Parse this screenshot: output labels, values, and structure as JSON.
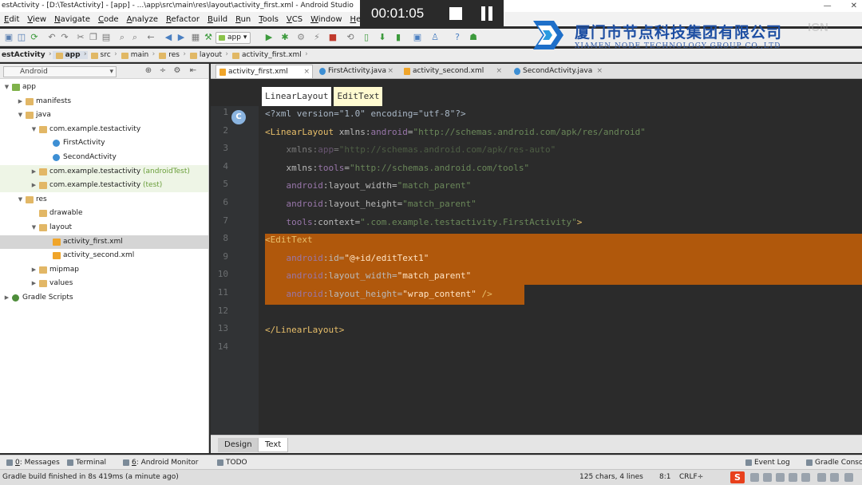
{
  "window": {
    "title": "estActivity - [D:\\TestActivity] - [app] - ...\\app\\src\\main\\res\\layout\\activity_first.xml - Android Studio"
  },
  "menu": [
    "Edit",
    "View",
    "Navigate",
    "Code",
    "Analyze",
    "Refactor",
    "Build",
    "Run",
    "Tools",
    "VCS",
    "Window",
    "Help"
  ],
  "toolbar": {
    "module": "app"
  },
  "breadcrumb": [
    "estActivity",
    "app",
    "src",
    "main",
    "res",
    "layout",
    "activity_first.xml"
  ],
  "project_panel": {
    "view_mode": "Android",
    "tree": [
      {
        "label": "app",
        "depth": 0,
        "arrow": "▼",
        "icon": "module"
      },
      {
        "label": "manifests",
        "depth": 1,
        "arrow": "▶",
        "icon": "folder"
      },
      {
        "label": "java",
        "depth": 1,
        "arrow": "▼",
        "icon": "folder"
      },
      {
        "label": "com.example.testactivity",
        "depth": 2,
        "arrow": "▼",
        "icon": "folder"
      },
      {
        "label": "FirstActivity",
        "depth": 3,
        "arrow": "",
        "icon": "class"
      },
      {
        "label": "SecondActivity",
        "depth": 3,
        "arrow": "",
        "icon": "class"
      },
      {
        "label": "com.example.testactivity",
        "suffix": "(androidTest)",
        "depth": 2,
        "arrow": "▶",
        "icon": "folder",
        "tinted": true
      },
      {
        "label": "com.example.testactivity",
        "suffix": "(test)",
        "depth": 2,
        "arrow": "▶",
        "icon": "folder",
        "tinted": true
      },
      {
        "label": "res",
        "depth": 1,
        "arrow": "▼",
        "icon": "folder"
      },
      {
        "label": "drawable",
        "depth": 2,
        "arrow": "",
        "icon": "folder"
      },
      {
        "label": "layout",
        "depth": 2,
        "arrow": "▼",
        "icon": "folder"
      },
      {
        "label": "activity_first.xml",
        "depth": 3,
        "arrow": "",
        "icon": "xml",
        "selected": true
      },
      {
        "label": "activity_second.xml",
        "depth": 3,
        "arrow": "",
        "icon": "xml"
      },
      {
        "label": "mipmap",
        "depth": 2,
        "arrow": "▶",
        "icon": "folder"
      },
      {
        "label": "values",
        "depth": 2,
        "arrow": "▶",
        "icon": "folder"
      },
      {
        "label": "Gradle Scripts",
        "depth": 0,
        "arrow": "▶",
        "icon": "gradle"
      }
    ]
  },
  "editor": {
    "tabs": [
      {
        "label": "activity_first.xml",
        "type": "xml",
        "active": true
      },
      {
        "label": "FirstActivity.java",
        "type": "java",
        "active": false
      },
      {
        "label": "activity_second.xml",
        "type": "xml",
        "active": false
      },
      {
        "label": "SecondActivity.java",
        "type": "java",
        "active": false
      }
    ],
    "tag_breadcrumb": [
      "LinearLayout",
      "EditText"
    ],
    "gutter_marker": "C",
    "line_numbers": [
      "1",
      "2",
      "3",
      "4",
      "5",
      "6",
      "7",
      "8",
      "9",
      "10",
      "11",
      "12",
      "13",
      "14"
    ],
    "selected_lines": [
      8,
      11
    ],
    "code": [
      [
        [
          "t",
          "<?xml version=\"1.0\" encoding=\"utf-8\"?>"
        ]
      ],
      [
        [
          "tag",
          "<LinearLayout "
        ],
        [
          "attr",
          "xmlns:"
        ],
        [
          "ns",
          "android"
        ],
        [
          "attr",
          "="
        ],
        [
          "val",
          "\"http://schemas.android.com/apk/res/android\""
        ]
      ],
      [
        [
          "t",
          "    "
        ],
        [
          "attr",
          "xmlns:"
        ],
        [
          "ns",
          "app"
        ],
        [
          "attr",
          "="
        ],
        [
          "val",
          "\"http://schemas.android.com/apk/res-auto\""
        ]
      ],
      [
        [
          "t",
          "    "
        ],
        [
          "attr",
          "xmlns:"
        ],
        [
          "ns",
          "tools"
        ],
        [
          "attr",
          "="
        ],
        [
          "val",
          "\"http://schemas.android.com/tools\""
        ]
      ],
      [
        [
          "t",
          "    "
        ],
        [
          "ns",
          "android"
        ],
        [
          "attr",
          ":layout_width="
        ],
        [
          "val",
          "\"match_parent\""
        ]
      ],
      [
        [
          "t",
          "    "
        ],
        [
          "ns",
          "android"
        ],
        [
          "attr",
          ":layout_height="
        ],
        [
          "val",
          "\"match_parent\""
        ]
      ],
      [
        [
          "t",
          "    "
        ],
        [
          "ns",
          "tools"
        ],
        [
          "attr",
          ":context="
        ],
        [
          "val",
          "\".com.example.testactivity.FirstActivity\""
        ],
        [
          "tag",
          ">"
        ]
      ],
      [
        [
          "tag",
          "<EditText"
        ]
      ],
      [
        [
          "t",
          "    "
        ],
        [
          "ns",
          "android"
        ],
        [
          "attr",
          ":id="
        ],
        [
          "val",
          "\"@+id/editText1\""
        ]
      ],
      [
        [
          "t",
          "    "
        ],
        [
          "ns",
          "android"
        ],
        [
          "attr",
          ":layout_width="
        ],
        [
          "val",
          "\"match_parent\""
        ]
      ],
      [
        [
          "t",
          "    "
        ],
        [
          "ns",
          "android"
        ],
        [
          "attr",
          ":layout_height="
        ],
        [
          "val",
          "\"wrap_content\""
        ],
        [
          "tag",
          " />"
        ]
      ],
      [],
      [
        [
          "tag",
          "</LinearLayout>"
        ]
      ],
      []
    ]
  },
  "design_tabs": [
    {
      "label": "Design",
      "active": false
    },
    {
      "label": "Text",
      "active": true
    }
  ],
  "tool_tabs": [
    {
      "num": "0",
      "label": ": Messages"
    },
    {
      "num": "",
      "label": "Terminal"
    },
    {
      "num": "6",
      "label": ": Android Monitor"
    },
    {
      "num": "",
      "label": "TODO"
    },
    {
      "num": "",
      "label": "Event Log"
    },
    {
      "num": "",
      "label": "Gradle Console"
    }
  ],
  "status": {
    "message": "Gradle build finished in 8s 419ms (a minute ago)",
    "chars": "125 chars, 4 lines",
    "position": "8:1",
    "line_sep": "CRLF÷",
    "ime": "S"
  },
  "recorder": {
    "time": "00:01:05"
  },
  "watermark": {
    "company_cn": "厦门市节点科技集团有限公司",
    "company_en": "XIAMEN NODE TECHNOLOGY GROUP CO.,LTD",
    "stamp": "ICN"
  }
}
